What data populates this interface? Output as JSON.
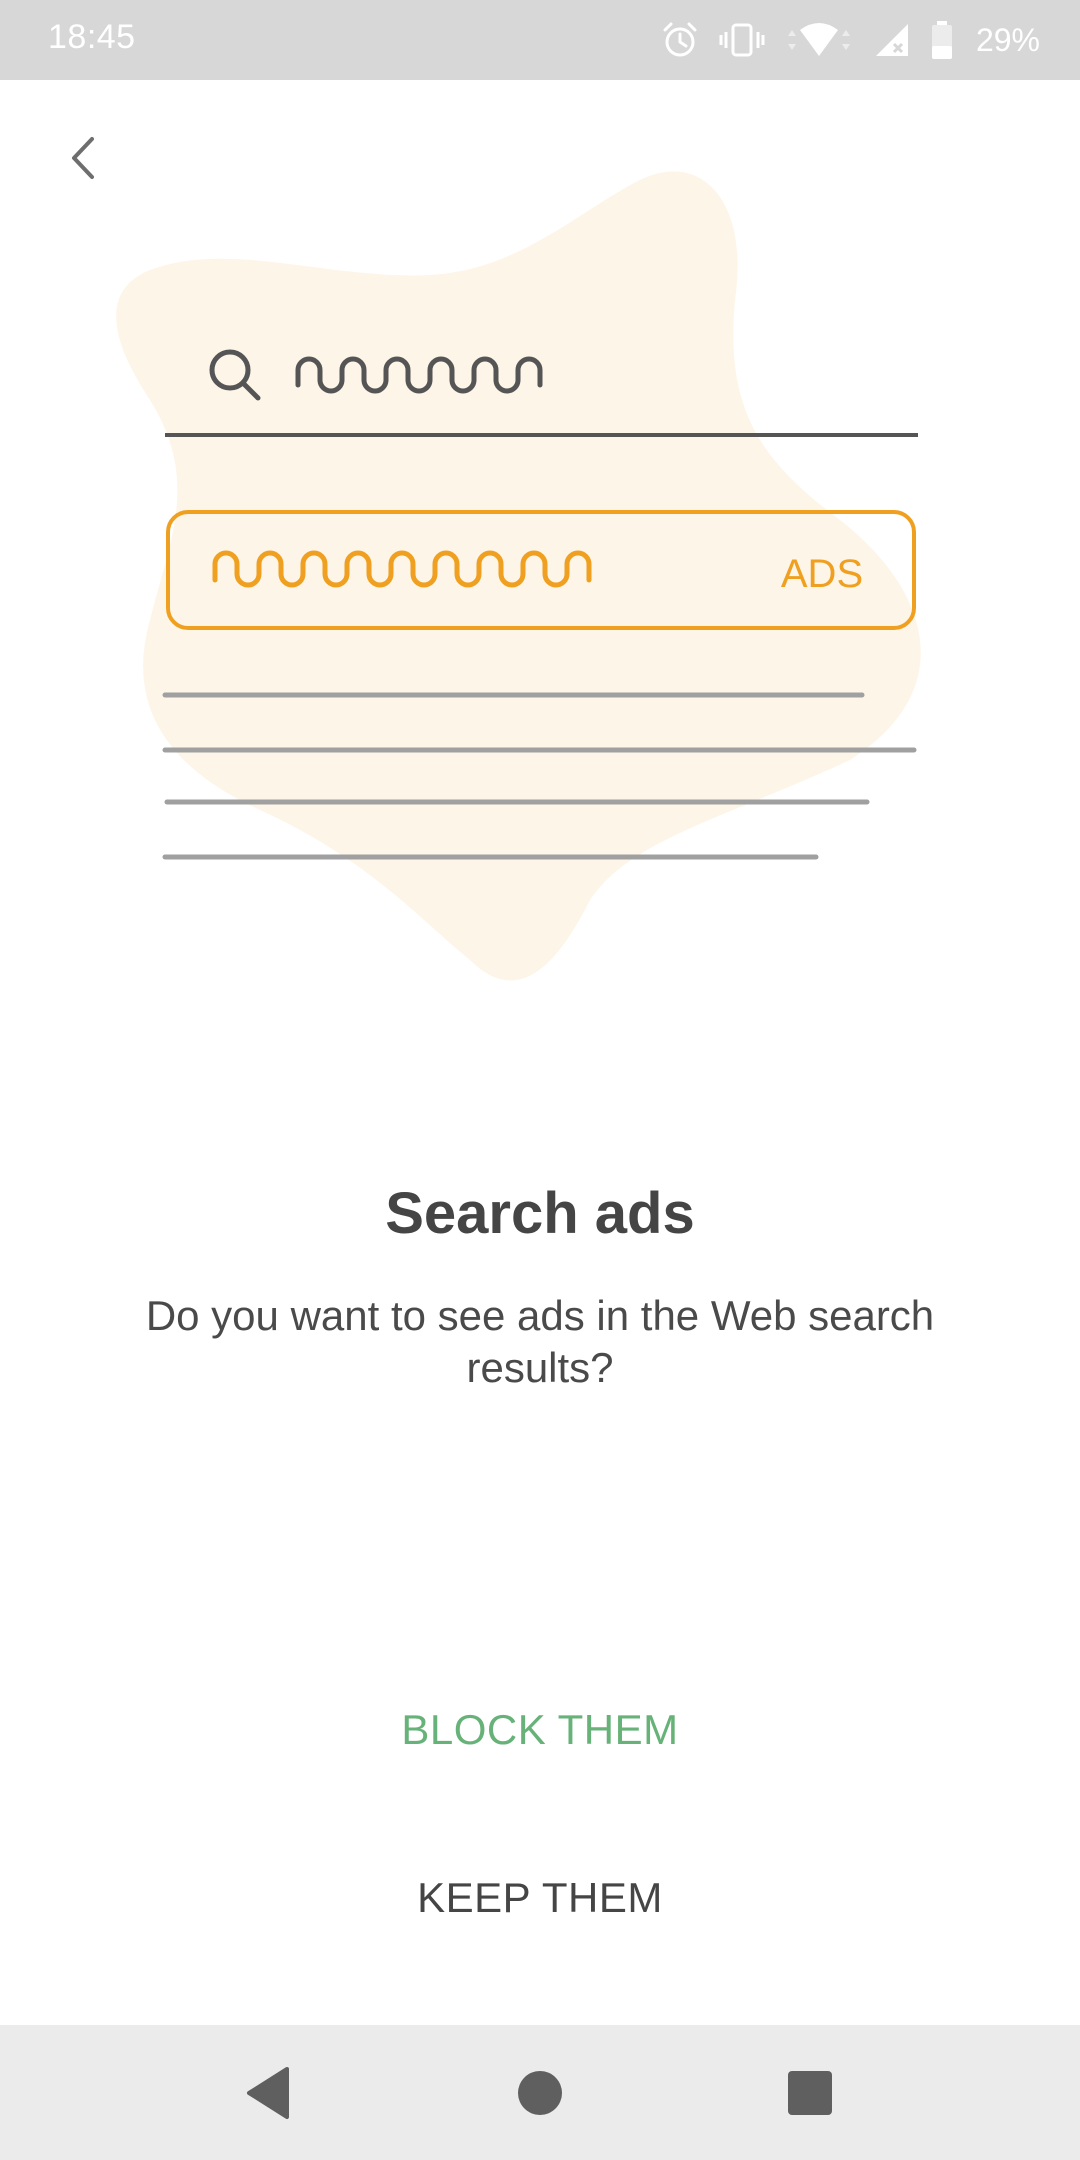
{
  "status_bar": {
    "time": "18:45",
    "battery_percent": "29%",
    "icons": [
      "alarm-icon",
      "vibrate-icon",
      "wifi-icon",
      "signal-icon",
      "battery-icon"
    ]
  },
  "navigation": {
    "back_icon": "chevron-left-icon"
  },
  "illustration": {
    "ads_label": "ADS",
    "colors": {
      "blob": "#fdf5e8",
      "accent": "#f0a020",
      "line_dark": "#555555",
      "line_light": "#a0a0a0"
    }
  },
  "content": {
    "title": "Search ads",
    "subtitle": "Do you want to see ads in the Web search results?"
  },
  "actions": {
    "block_label": "BLOCK THEM",
    "keep_label": "KEEP THEM",
    "block_color": "#67b279"
  },
  "system_nav": {
    "back": "nav-back-icon",
    "home": "nav-home-icon",
    "recents": "nav-recents-icon"
  }
}
